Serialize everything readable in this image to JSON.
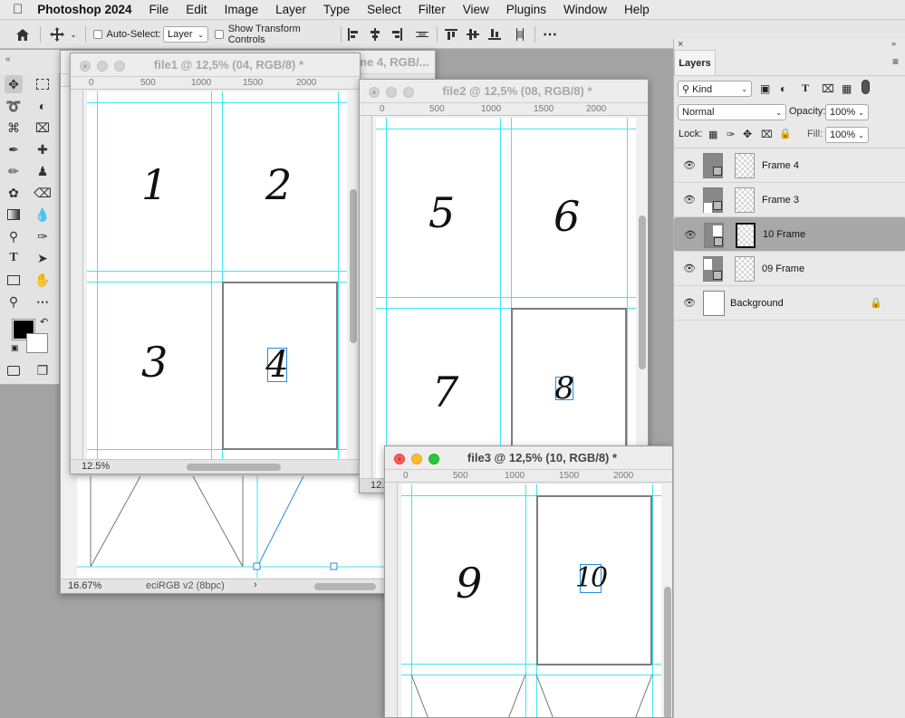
{
  "menubar": {
    "app": "Photoshop 2024",
    "items": [
      "File",
      "Edit",
      "Image",
      "Layer",
      "Type",
      "Select",
      "Filter",
      "View",
      "Plugins",
      "Window",
      "Help"
    ]
  },
  "options": {
    "auto_select_label": "Auto-Select:",
    "auto_select_value": "Layer",
    "transform_label": "Show Transform Controls"
  },
  "windows": {
    "back": {
      "title": "me 4, RGB/...",
      "zoom": "16.67%",
      "profile": "eciRGB v2 (8bpc)"
    },
    "file1": {
      "title": "file1 @ 12,5% (04, RGB/8) *",
      "zoom": "12.5%",
      "ruler": [
        "0",
        "500",
        "1000",
        "1500",
        "2000"
      ],
      "numbers": [
        "1",
        "2",
        "3",
        "4"
      ]
    },
    "file2": {
      "title": "file2 @ 12,5% (08, RGB/8) *",
      "zoom": "12.",
      "ruler": [
        "0",
        "500",
        "1000",
        "1500",
        "2000"
      ],
      "numbers": [
        "5",
        "6",
        "7",
        "8"
      ]
    },
    "file3": {
      "title": "file3 @ 12,5% (10, RGB/8) *",
      "ruler": [
        "0",
        "500",
        "1000",
        "1500",
        "2000"
      ],
      "numbers": [
        "9",
        "10"
      ]
    }
  },
  "layers_panel": {
    "tab": "Layers",
    "filter": "Kind",
    "blend": "Normal",
    "opacity_label": "Opacity:",
    "opacity": "100%",
    "lock_label": "Lock:",
    "fill_label": "Fill:",
    "fill": "100%",
    "layers": [
      {
        "name": "Frame 4",
        "selected": false
      },
      {
        "name": "Frame 3",
        "selected": false
      },
      {
        "name": "10 Frame",
        "selected": true
      },
      {
        "name": "09 Frame",
        "selected": false
      },
      {
        "name": "Background",
        "selected": false
      }
    ]
  },
  "colors": {
    "guide": "#3fe6ee",
    "selection": "#2a8ae0",
    "frame": "#7d7d7d"
  }
}
